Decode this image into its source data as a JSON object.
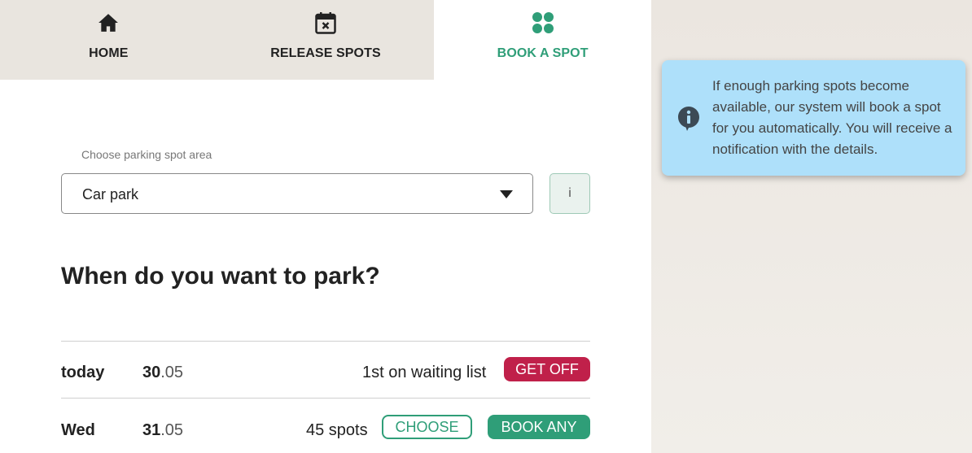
{
  "tabs": [
    {
      "label": "HOME",
      "icon": "home-icon",
      "active": false
    },
    {
      "label": "RELEASE SPOTS",
      "icon": "calendar-x-icon",
      "active": false
    },
    {
      "label": "BOOK A SPOT",
      "icon": "four-dots-icon",
      "active": true
    }
  ],
  "form": {
    "area_label": "Choose parking spot area",
    "area_value": "Car park",
    "info_button": "i"
  },
  "heading": "When do you want to park?",
  "rows": [
    {
      "day": "today",
      "date_day": "30",
      "date_month": ".05",
      "status": "1st on waiting list",
      "button": "GET OFF"
    },
    {
      "day": "Wed",
      "date_day": "31",
      "date_month": ".05",
      "status": "45 spots",
      "choose_button": "CHOOSE",
      "book_button": "BOOK ANY"
    }
  ],
  "tooltip": {
    "icon": "info-bubble-icon",
    "text": "If enough parking spots become available, our system will book a spot for you automatically. You will receive a notification with the details."
  },
  "colors": {
    "accent_green": "#2f9e78",
    "danger_red": "#c0204a",
    "tooltip_bg": "#aee0fa",
    "tab_bg": "#e9e5df"
  }
}
